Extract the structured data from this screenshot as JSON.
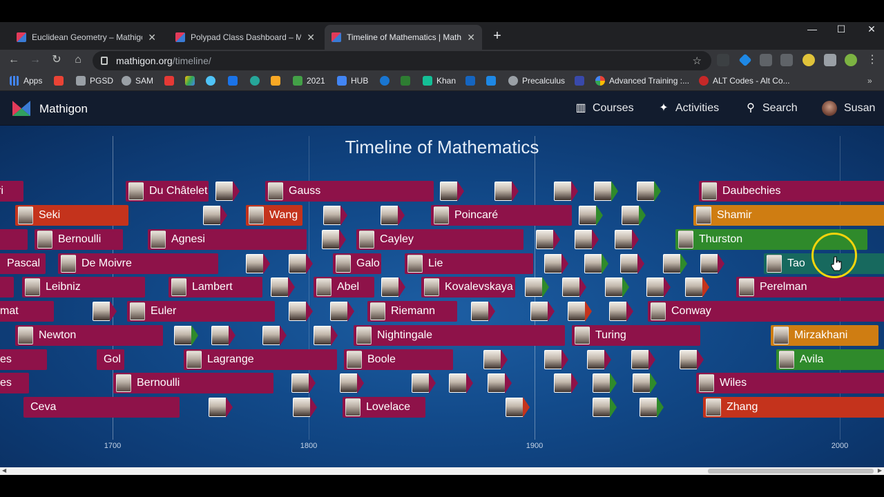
{
  "browser": {
    "tabs": [
      {
        "title": "Euclidean Geometry – Mathigon",
        "active": false
      },
      {
        "title": "Polypad Class Dashboard – Math",
        "active": false
      },
      {
        "title": "Timeline of Mathematics | Mathig",
        "active": true
      }
    ],
    "address": {
      "host": "mathigon.org",
      "path": "/timeline/"
    },
    "bookmarks": [
      "Apps",
      "PGSD",
      "SAM",
      "2021",
      "HUB",
      "Khan",
      "Precalculus",
      "Advanced Training :...",
      "ALT Codes - Alt Co..."
    ]
  },
  "header": {
    "brand": "Mathigon",
    "nav": {
      "courses": "Courses",
      "activities": "Activities",
      "search": "Search",
      "user": "Susan"
    }
  },
  "timeline": {
    "title": "Timeline of Mathematics",
    "years": [
      "1700",
      "1800",
      "1900",
      "2000"
    ],
    "labels": {
      "ferrari": "ri",
      "du_chatelet": "Du Châtelet",
      "gauss": "Gauss",
      "daubechies": "Daubechies",
      "seki": "Seki",
      "wang": "Wang",
      "poincare": "Poincaré",
      "shamir": "Shamir",
      "bernoulli1": "Bernoulli",
      "agnesi": "Agnesi",
      "cayley": "Cayley",
      "thurston": "Thurston",
      "pascal": "Pascal",
      "de_moivre": "De Moivre",
      "galois": "Galo",
      "lie": "Lie",
      "tao": "Tao",
      "leibniz": "Leibniz",
      "lambert": "Lambert",
      "abel": "Abel",
      "kovalevskaya": "Kovalevskaya",
      "perelman": "Perelman",
      "fermat": "mat",
      "euler": "Euler",
      "riemann": "Riemann",
      "conway": "Conway",
      "newton": "Newton",
      "nightingale": "Nightingale",
      "turing": "Turing",
      "mirzakhani": "Mirzakhani",
      "descartes": "es",
      "goldbach": "Gol",
      "lagrange": "Lagrange",
      "boole": "Boole",
      "avila": "Avila",
      "huygens": "es",
      "bernoulli2": "Bernoulli",
      "wiles": "Wiles",
      "ceva": "Ceva",
      "lovelace": "Lovelace",
      "zhang": "Zhang"
    }
  },
  "colors": {
    "magenta": "#8e1249",
    "red": "#c4331c",
    "orange": "#cf7d12",
    "green": "#2f8a2b",
    "teal": "#17695e"
  }
}
